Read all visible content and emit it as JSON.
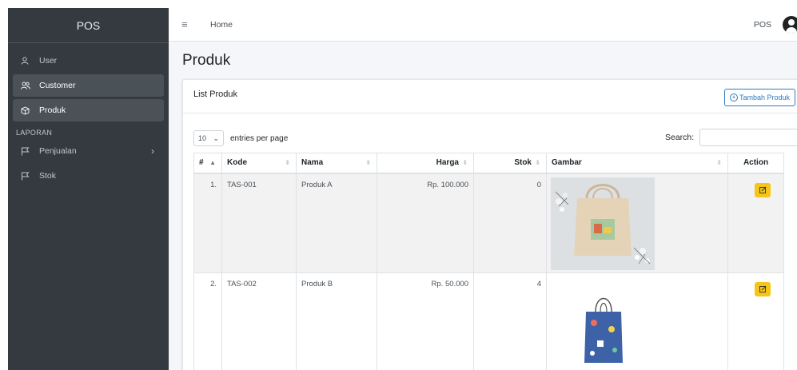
{
  "sidebar": {
    "brand": "POS",
    "items": [
      {
        "label": "User",
        "icon": "user-icon"
      },
      {
        "label": "Customer",
        "icon": "users-icon"
      },
      {
        "label": "Produk",
        "icon": "cube-icon"
      }
    ],
    "section_header": "LAPORAN",
    "report_items": [
      {
        "label": "Penjualan",
        "icon": "flag-icon"
      },
      {
        "label": "Stok",
        "icon": "flag-icon"
      }
    ]
  },
  "topbar": {
    "home": "Home",
    "user": "POS"
  },
  "page": {
    "title": "Produk",
    "card_title": "List Produk",
    "add_button": "Tambah Produk",
    "entries_value": "10",
    "entries_label": "entries per page",
    "search_label": "Search:"
  },
  "table": {
    "headers": [
      "#",
      "Kode",
      "Nama",
      "Harga",
      "Stok",
      "Gambar",
      "Action"
    ],
    "rows": [
      {
        "no": "1.",
        "kode": "TAS-001",
        "nama": "Produk A",
        "harga": "Rp. 100.000",
        "stok": "0",
        "image": "tote-bag-image"
      },
      {
        "no": "2.",
        "kode": "TAS-002",
        "nama": "Produk B",
        "harga": "Rp. 50.000",
        "stok": "4",
        "image": "gift-bag-image"
      }
    ]
  },
  "colors": {
    "sidebar_bg": "#343a40",
    "content_bg": "#f4f6f9",
    "primary": "#2e7bc4",
    "warning": "#f5c518"
  }
}
